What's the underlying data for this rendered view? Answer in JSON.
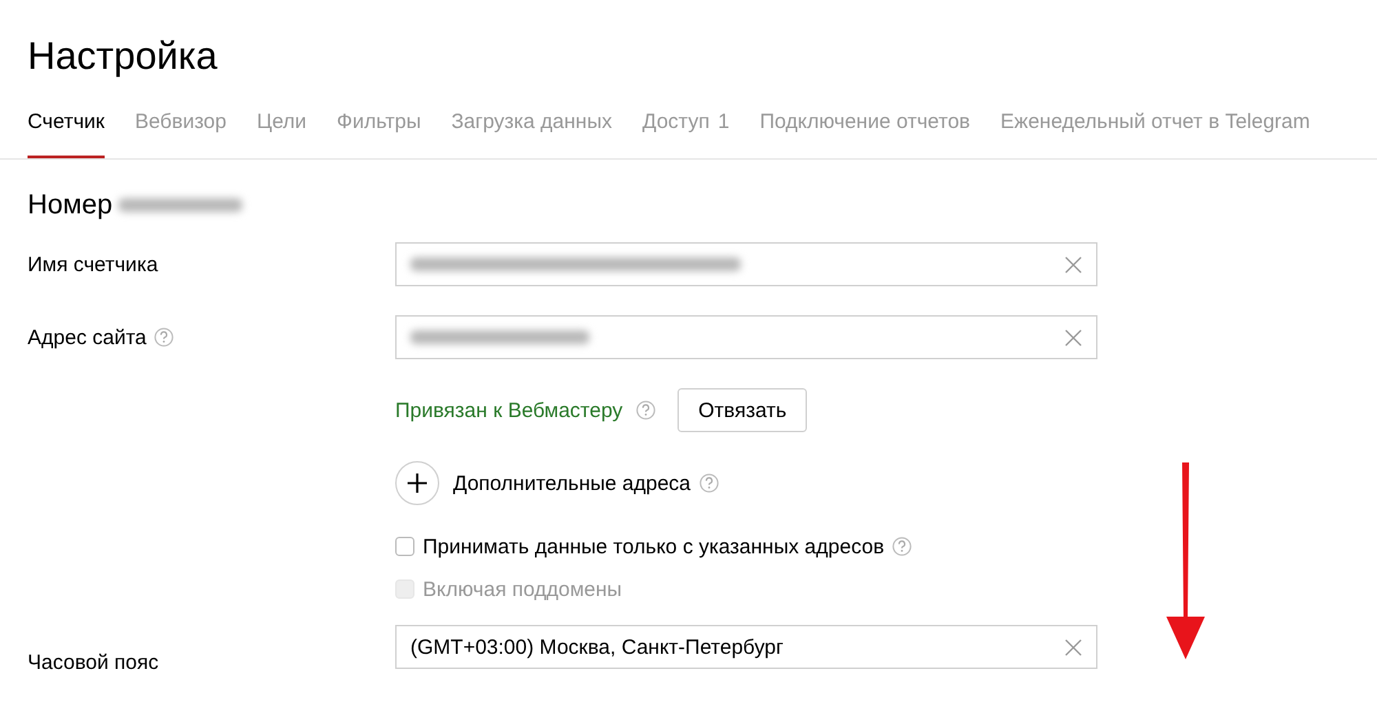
{
  "page_title": "Настройка",
  "tabs": [
    {
      "label": "Счетчик",
      "selected": true
    },
    {
      "label": "Вебвизор",
      "selected": false
    },
    {
      "label": "Цели",
      "selected": false
    },
    {
      "label": "Фильтры",
      "selected": false
    },
    {
      "label": "Загрузка данных",
      "selected": false
    },
    {
      "label": "Доступ",
      "count": "1",
      "selected": false
    },
    {
      "label": "Подключение отчетов",
      "selected": false
    },
    {
      "label": "Еженедельный отчет в Telegram",
      "selected": false
    }
  ],
  "counter_heading": "Номер",
  "fields": [
    {
      "label": "Имя счетчика",
      "help": false
    },
    {
      "label": "Адрес сайта",
      "help": true
    }
  ],
  "webmaster": {
    "status": "Привязан к Вебмастеру",
    "help": true,
    "button": "Отвязать"
  },
  "additional_addresses": {
    "label": "Дополнительные адреса",
    "help": true
  },
  "checkboxes": [
    {
      "label": "Принимать данные только с указанных адресов",
      "checked": false,
      "disabled": false,
      "help": true
    },
    {
      "label": "Включая поддомены",
      "checked": false,
      "disabled": true,
      "help": false
    }
  ],
  "timezone": {
    "label": "Часовой пояс",
    "value": "(GMT+03:00) Москва, Санкт-Петербург"
  },
  "annotation": {
    "kind": "arrow"
  }
}
